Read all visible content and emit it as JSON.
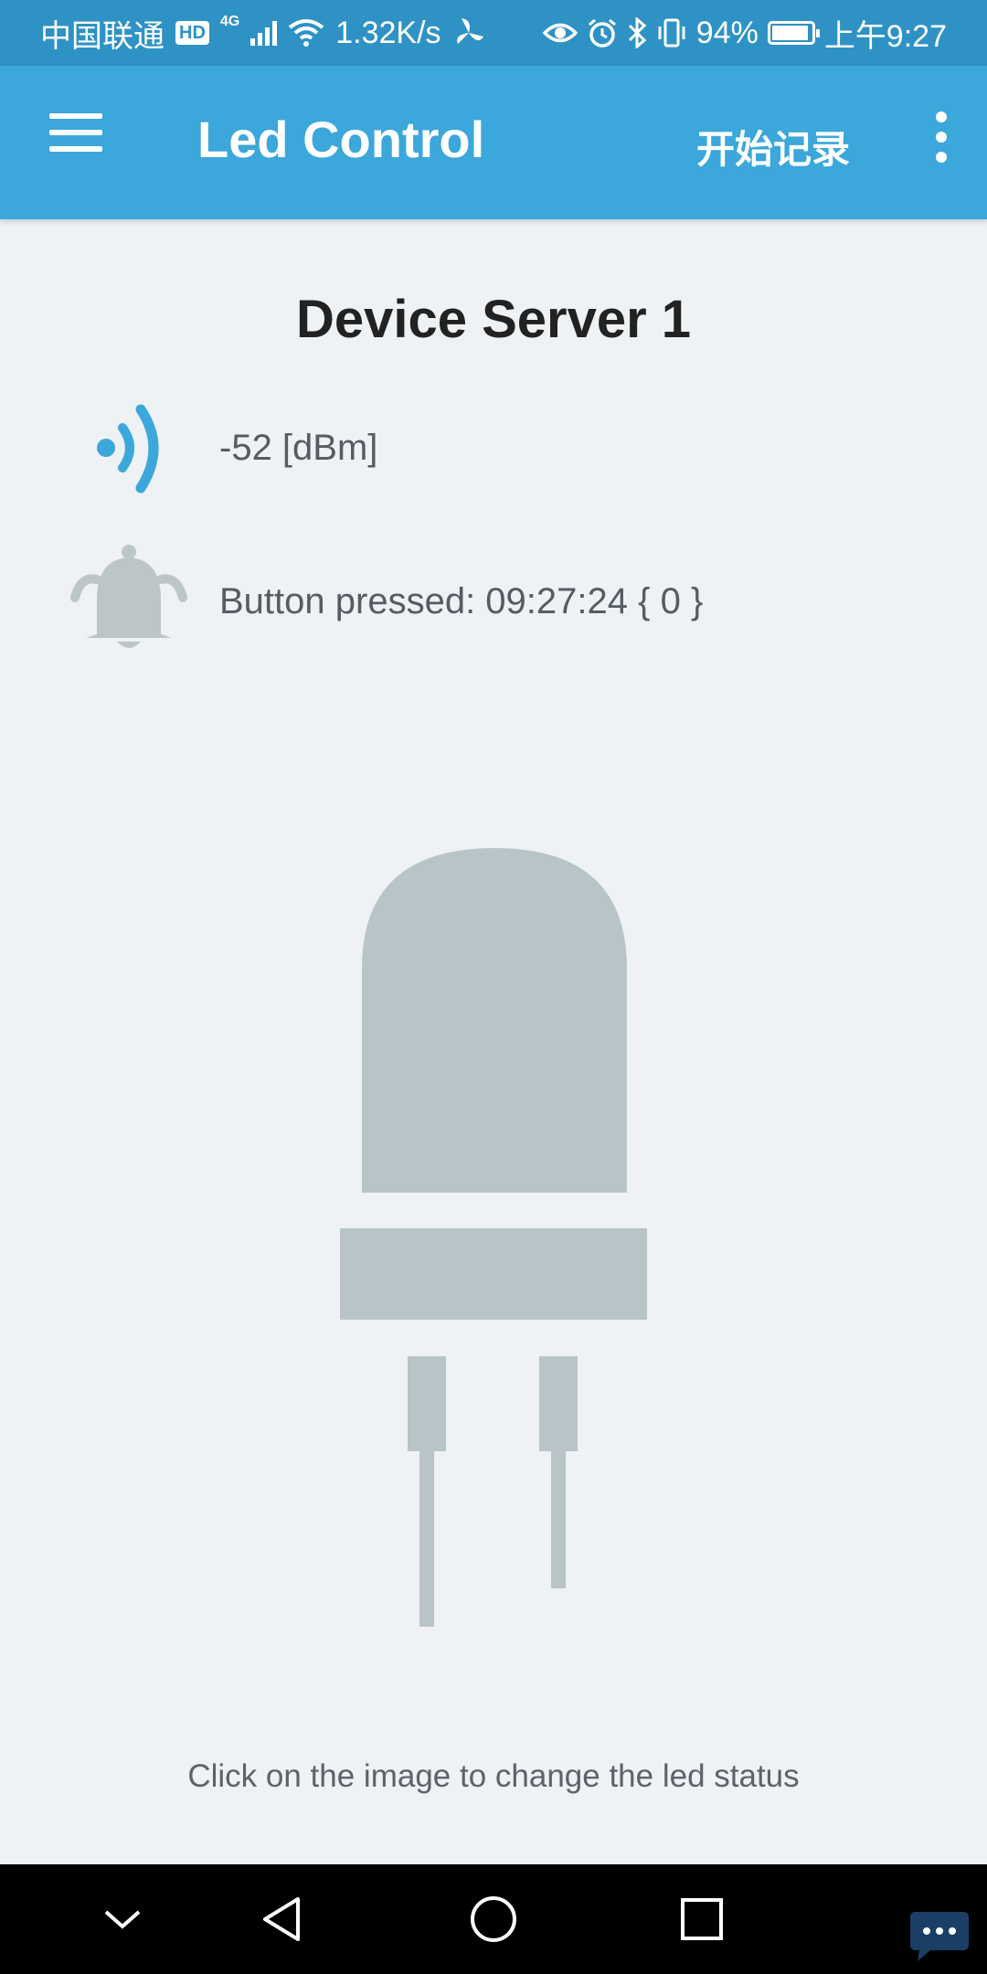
{
  "status_bar": {
    "carrier": "中国联通",
    "hd_label": "HD",
    "network_type": "4G",
    "speed": "1.32K/s",
    "battery_percent": "94%",
    "battery_level": 0.94,
    "time": "上午9:27",
    "icons": [
      "hd-icon",
      "signal-icon",
      "wifi-icon",
      "fan-icon",
      "eye-icon",
      "alarm-icon",
      "bluetooth-icon",
      "vibrate-icon",
      "battery-icon"
    ]
  },
  "app_bar": {
    "title": "Led Control",
    "record_label": "开始记录",
    "background": "#3ca7da",
    "icons": [
      "menu-icon",
      "overflow-menu-icon"
    ]
  },
  "device": {
    "title": "Device Server 1",
    "rssi": "-52 [dBm]",
    "button_status": "Button pressed: 09:27:24 { 0 }",
    "signal_icon_color": "#3ca7da",
    "bell_icon_color": "#bcc6c9",
    "led_state": "off",
    "led_color": "#b8c4c7"
  },
  "hint": "Click on the image to change the led status",
  "nav_bar": {
    "icons": [
      "chevron-down-icon",
      "back-icon",
      "home-icon",
      "recents-icon",
      "chat-icon"
    ]
  }
}
